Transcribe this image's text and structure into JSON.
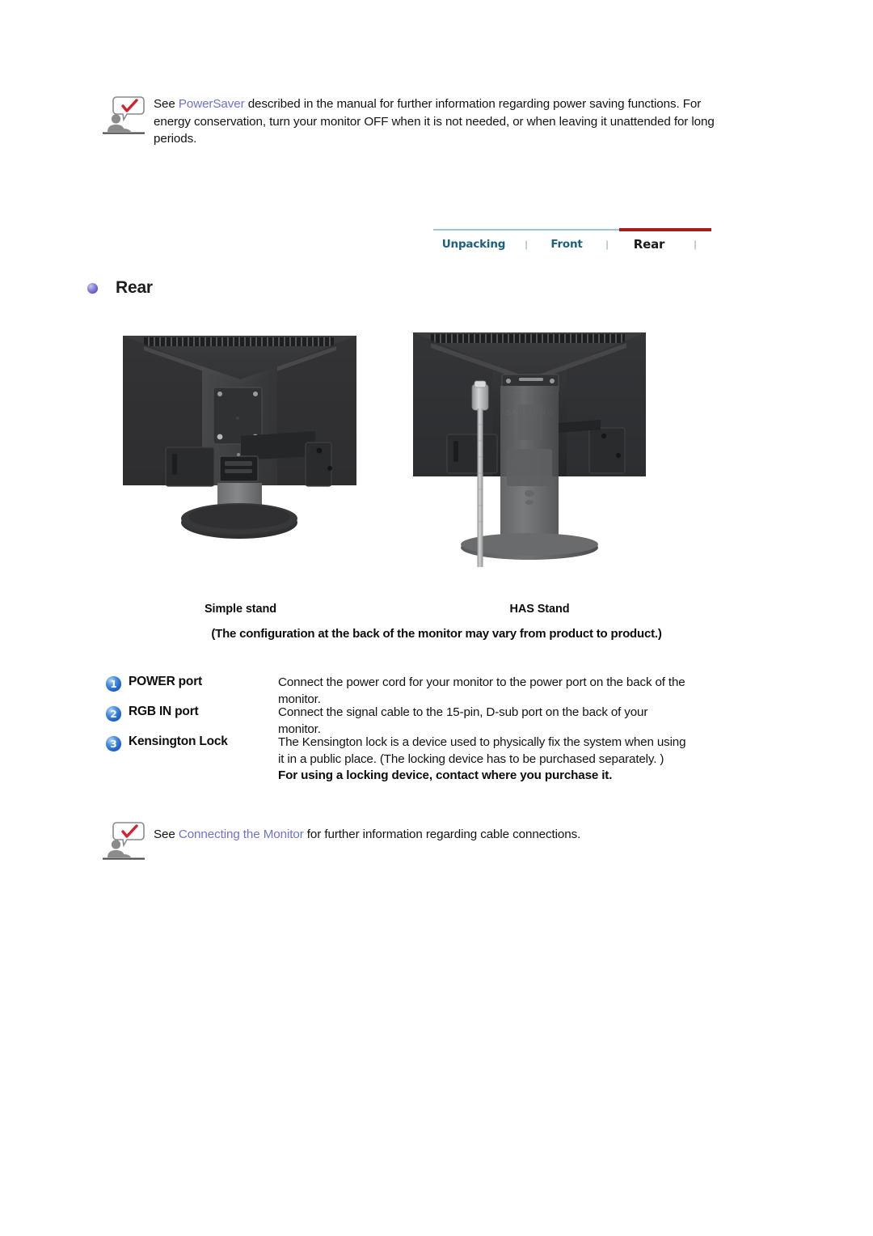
{
  "top_note": {
    "icon": "note-person-checkmark-icon",
    "text_before_link": "See ",
    "link": "PowerSaver",
    "text_after_link": " described in the manual for further information regarding power saving functions. For energy conservation, turn your monitor OFF when it is not needed, or when leaving it unattended for long periods."
  },
  "nav": {
    "tabs": [
      {
        "label": "Unpacking",
        "active": false
      },
      {
        "label": "Front",
        "active": false
      },
      {
        "label": "Rear",
        "active": true
      }
    ],
    "separator": "|",
    "active_color": "#a51c1c",
    "inactive_color": "#1d5f7e",
    "rule_color": "#9fc4d8"
  },
  "section": {
    "bullet": "purple-sphere-bullet-icon",
    "title": "Rear"
  },
  "figures": [
    {
      "caption": "Simple stand",
      "alt": "rear-view-monitor-simple-stand"
    },
    {
      "caption": "HAS Stand",
      "alt": "rear-view-monitor-has-stand"
    }
  ],
  "figure_note": "(The configuration at the back of the monitor may vary from product to product.)",
  "ports": [
    {
      "number": "1",
      "label": "POWER port",
      "description": "Connect the power cord for your monitor to the power port on the back of the monitor."
    },
    {
      "number": "2",
      "label": "RGB IN port",
      "description": "Connect the signal cable to the 15-pin, D-sub port on the back of your monitor."
    },
    {
      "number": "3",
      "label": "Kensington Lock",
      "description": "The Kensington lock is a device used to physically fix the system when using it in a public place. (The locking device has to be purchased separately. )",
      "emphasis": "For using a locking device, contact where you purchase it."
    }
  ],
  "bottom_note": {
    "icon": "note-person-checkmark-icon",
    "text_before_link": "See ",
    "link": "Connecting the Monitor",
    "text_after_link": " for further information regarding cable connections."
  }
}
